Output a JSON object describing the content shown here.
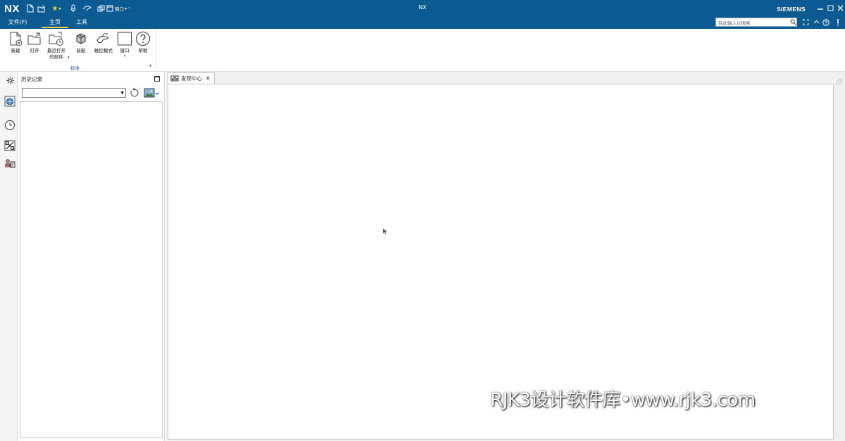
{
  "titlebar": {
    "logo": "NX",
    "app_title": "NX",
    "brand": "SIEMENS",
    "window_menu_label": "窗口",
    "menu_tabs": [
      {
        "label": "文件(F)"
      },
      {
        "label": "主页"
      },
      {
        "label": "工具"
      }
    ],
    "search_placeholder": "在此输入以搜索"
  },
  "ribbon": {
    "buttons": [
      {
        "label": "新建"
      },
      {
        "label": "打开"
      },
      {
        "label": "最近打开\n的部件"
      },
      {
        "label": "装配"
      },
      {
        "label": "触控模式"
      },
      {
        "label": "窗口"
      },
      {
        "label": "帮助"
      }
    ],
    "group_label": "标准"
  },
  "history": {
    "title": "历史记录"
  },
  "documents": {
    "tabs": [
      {
        "label": "发现中心"
      }
    ]
  },
  "watermark": "RJK3设计软件库•www.rjk3.com",
  "colors": {
    "titlebar": "#0b5b92",
    "active_tab_underline": "#ffcc33",
    "group_label": "#1a5e9a"
  }
}
